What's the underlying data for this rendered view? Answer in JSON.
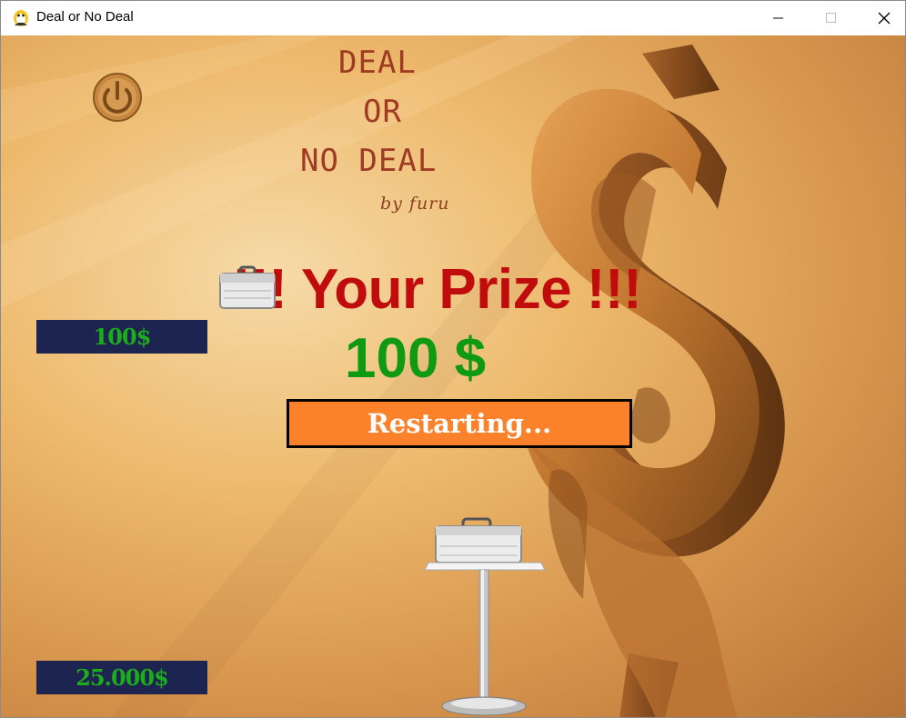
{
  "window": {
    "title": "Deal or No Deal",
    "controls": {
      "minimize": "minimize",
      "maximize": "maximize",
      "close": "close"
    }
  },
  "game": {
    "title_lines": [
      "DEAL",
      "OR",
      "NO DEAL"
    ],
    "byline": "by furu",
    "prize_title": "!!! Your Prize !!!",
    "prize_amount": "100 $",
    "restart_button": "Restarting...",
    "amount_boxes": [
      "100$",
      "25.000$"
    ]
  },
  "colors": {
    "title": "#9e3b22",
    "prize_title": "#c00c0c",
    "prize_amount": "#0f9a12",
    "restart_bg": "#fc812b",
    "amount_box_bg": "#1d2450",
    "amount_text": "#1cad1c"
  },
  "icons": [
    "app-icon",
    "power-icon",
    "briefcase-icon",
    "briefcase-on-stand"
  ]
}
